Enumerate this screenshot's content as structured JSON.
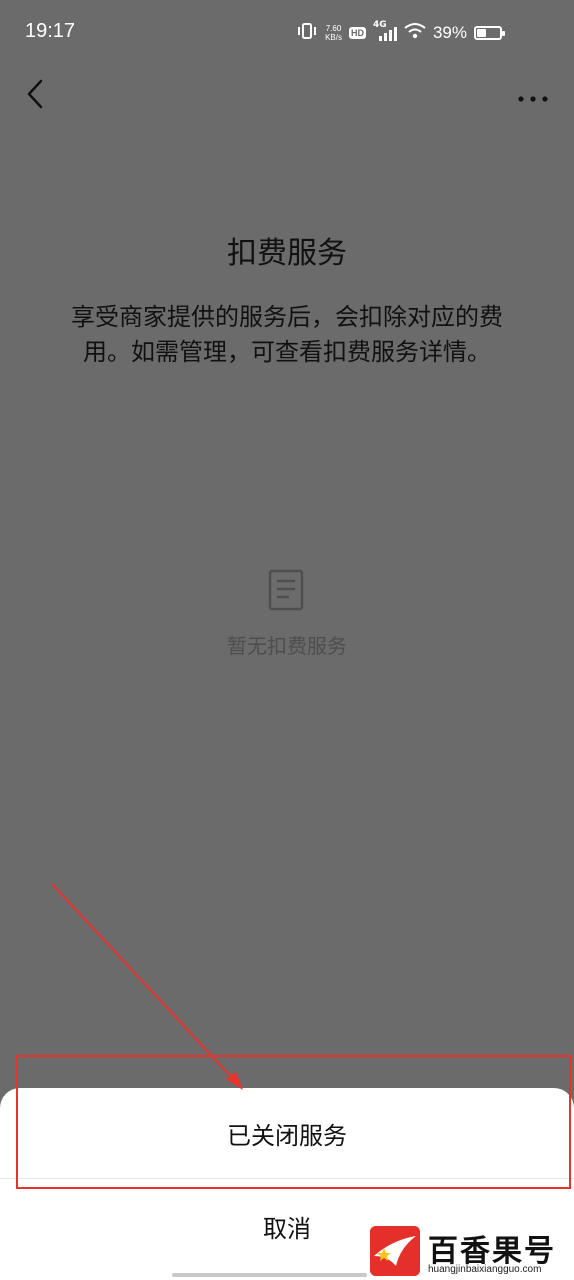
{
  "status_bar": {
    "time": "19:17",
    "net_speed_value": "7.60",
    "net_speed_unit": "KB/s",
    "hd_label": "HD",
    "network_label": "4G",
    "battery_percent": "39%",
    "battery_level": 0.39
  },
  "icons": {
    "back": "chevron-left-icon",
    "more": "more-dots-icon",
    "empty": "document-icon"
  },
  "page": {
    "title": "扣费服务",
    "description": "享受商家提供的服务后，会扣除对应的费用。如需管理，可查看扣费服务详情。",
    "empty_text": "暂无扣费服务"
  },
  "action_sheet": {
    "option_label": "已关闭服务",
    "cancel_label": "取消"
  },
  "annotation": {
    "color": "#e8322c"
  },
  "watermark": {
    "title": "百香果号",
    "url": "huangjinbaixiangguo.com",
    "color": "#e52f2b"
  }
}
